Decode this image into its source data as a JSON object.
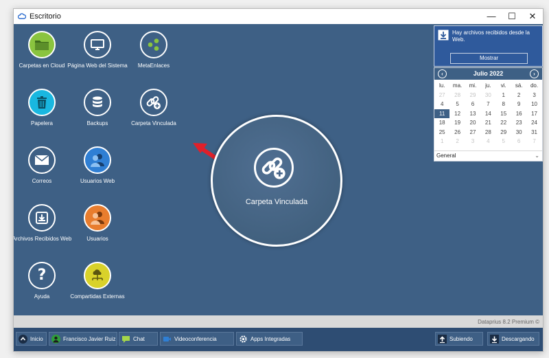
{
  "window": {
    "title": "Escritorio",
    "controls": {
      "minimize": "—",
      "maximize": "☐",
      "close": "✕"
    }
  },
  "desktop_icons": [
    {
      "label": "Carpetas en Cloud",
      "icon": "folder-icon",
      "color": "#8ac43f"
    },
    {
      "label": "Página Web del Sistema",
      "icon": "monitor-icon",
      "color": "#3e6085"
    },
    {
      "label": "MetaEnlaces",
      "icon": "share-nodes-icon",
      "color": "#3e6085"
    },
    {
      "label": "Papelera",
      "icon": "trash-icon",
      "color": "#19b7e0"
    },
    {
      "label": "Backups",
      "icon": "database-icon",
      "color": "#3e6085"
    },
    {
      "label": "Carpeta Vinculada",
      "icon": "link-plus-icon",
      "color": "#3e6085"
    },
    {
      "label": "Correos",
      "icon": "envelope-icon",
      "color": "#3e6085"
    },
    {
      "label": "Usuarios Web",
      "icon": "users-icon",
      "color": "#2f7fd4"
    },
    {
      "label": "Archivos Recibidos Web",
      "icon": "inbox-download-icon",
      "color": "#3e6085"
    },
    {
      "label": "Usuarios",
      "icon": "users-icon",
      "color": "#e87d2e"
    },
    {
      "label": "Ayuda",
      "icon": "question-icon",
      "color": "#3e6085"
    },
    {
      "label": "Compartidas Externas",
      "icon": "network-cloud-icon",
      "color": "#d9d22a"
    }
  ],
  "spotlight": {
    "label": "Carpeta Vinculada",
    "icon": "link-plus-icon"
  },
  "notification": {
    "text": "Hay archivos recibidos desde la Web.",
    "button": "Mostrar",
    "icon": "download-icon"
  },
  "calendar": {
    "month": "Julio 2022",
    "weekdays": [
      "lu.",
      "ma.",
      "mi.",
      "ju.",
      "vi.",
      "sá.",
      "do."
    ],
    "weeks": [
      [
        {
          "d": "27",
          "o": true
        },
        {
          "d": "28",
          "o": true
        },
        {
          "d": "29",
          "o": true
        },
        {
          "d": "30",
          "o": true
        },
        {
          "d": "1"
        },
        {
          "d": "2"
        },
        {
          "d": "3"
        }
      ],
      [
        {
          "d": "4"
        },
        {
          "d": "5"
        },
        {
          "d": "6"
        },
        {
          "d": "7"
        },
        {
          "d": "8"
        },
        {
          "d": "9"
        },
        {
          "d": "10"
        }
      ],
      [
        {
          "d": "11",
          "t": true
        },
        {
          "d": "12"
        },
        {
          "d": "13"
        },
        {
          "d": "14"
        },
        {
          "d": "15"
        },
        {
          "d": "16"
        },
        {
          "d": "17"
        }
      ],
      [
        {
          "d": "18"
        },
        {
          "d": "19"
        },
        {
          "d": "20"
        },
        {
          "d": "21"
        },
        {
          "d": "22"
        },
        {
          "d": "23"
        },
        {
          "d": "24"
        }
      ],
      [
        {
          "d": "25"
        },
        {
          "d": "26"
        },
        {
          "d": "27"
        },
        {
          "d": "28"
        },
        {
          "d": "29"
        },
        {
          "d": "30"
        },
        {
          "d": "31"
        }
      ],
      [
        {
          "d": "1",
          "o": true
        },
        {
          "d": "2",
          "o": true
        },
        {
          "d": "3",
          "o": true
        },
        {
          "d": "4",
          "o": true
        },
        {
          "d": "5",
          "o": true
        },
        {
          "d": "6",
          "o": true
        },
        {
          "d": "7",
          "o": true
        }
      ]
    ],
    "filter": "General"
  },
  "status": {
    "version": "Dataprius 8.2 Premium ©"
  },
  "taskbar": {
    "inicio": "Inicio",
    "user": "Francisco Javier Ruiz",
    "chat": "Chat",
    "video": "Videoconferencia",
    "apps": "Apps Integradas",
    "subiendo": "Subiendo",
    "descargando": "Descargando"
  },
  "colors": {
    "desktop": "#3e6085",
    "accent_arrow": "#e0202a",
    "taskbar": "#2e4d73"
  }
}
